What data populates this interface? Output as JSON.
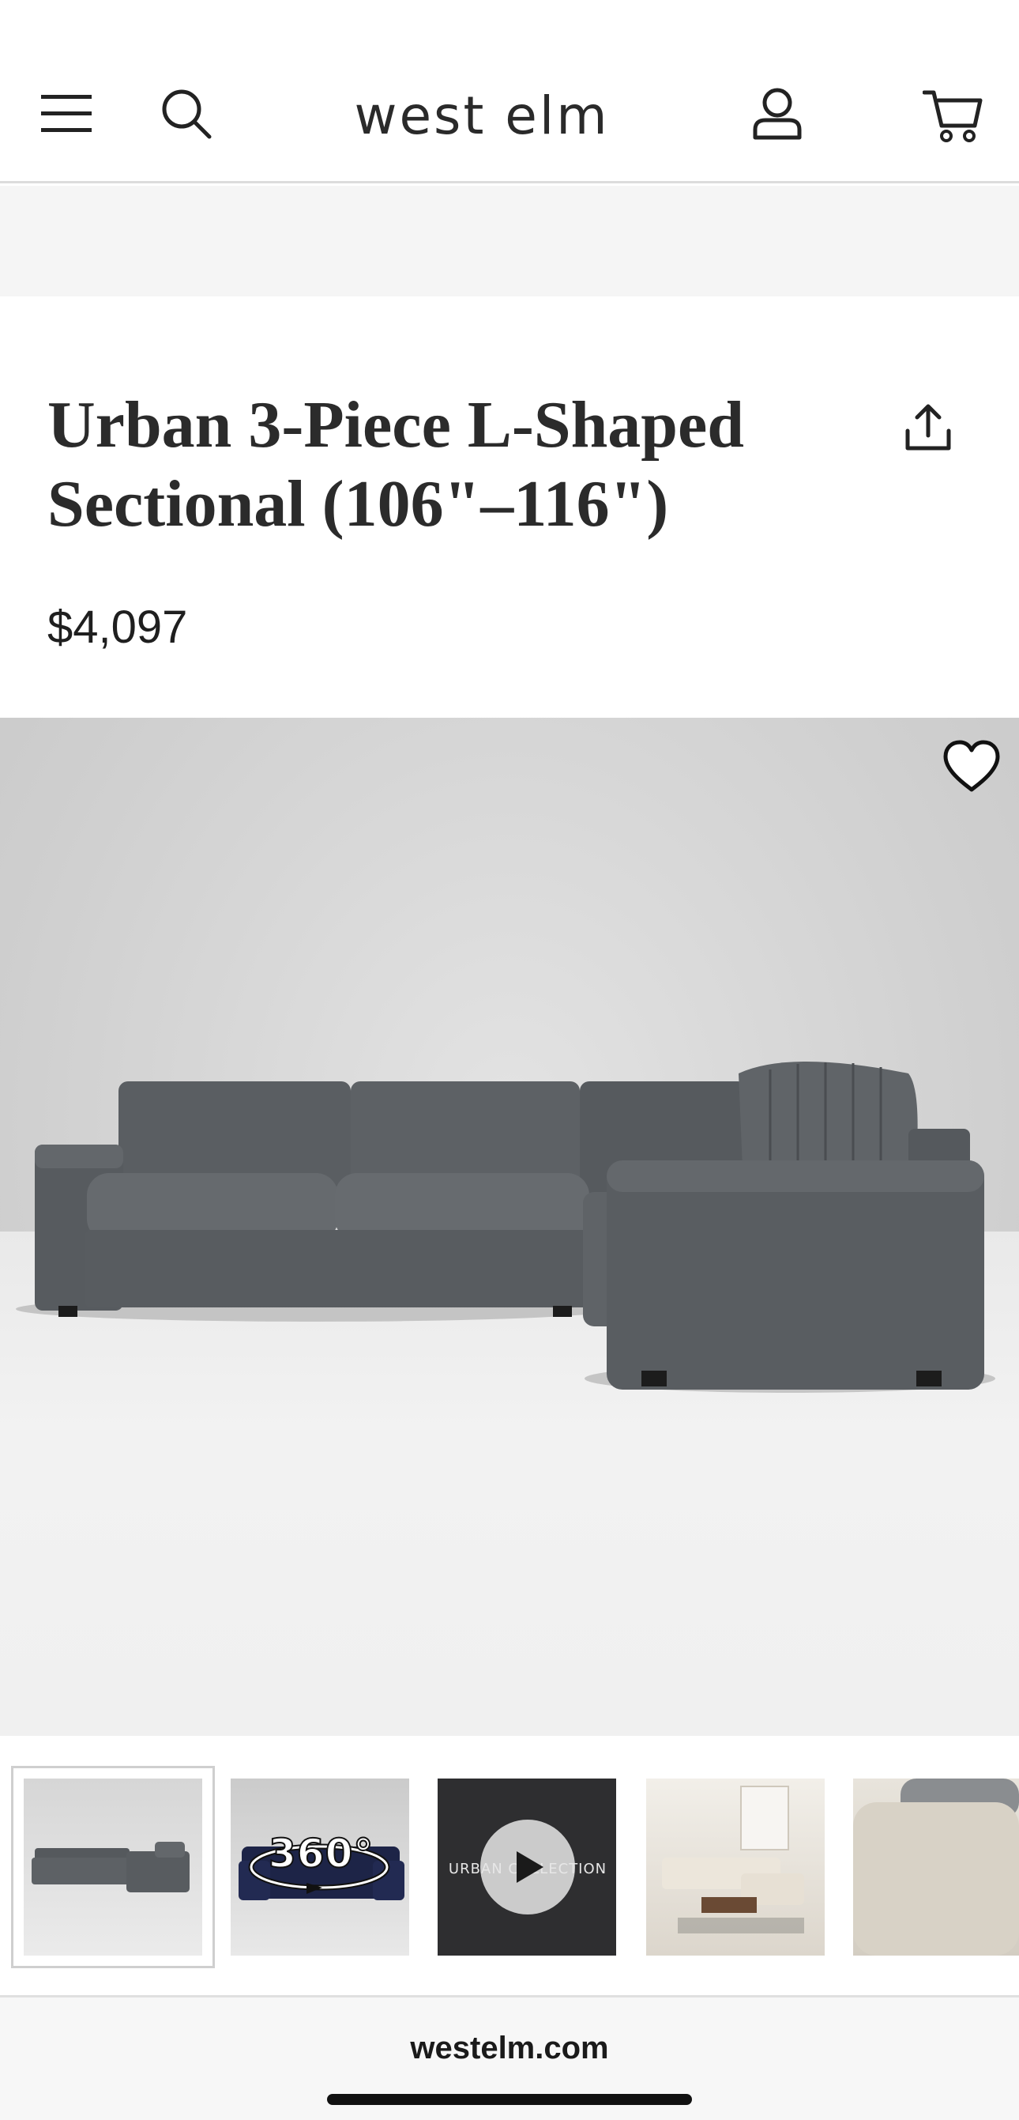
{
  "header": {
    "logo": "west elm",
    "icons": {
      "menu": "hamburger-menu-icon",
      "search": "search-icon",
      "account": "account-icon",
      "cart": "cart-icon"
    }
  },
  "product": {
    "title_line1": "Urban 3-Piece L-Shaped",
    "title_line2": "Sectional (106\"–116\")",
    "price": "$4,097",
    "share_icon": "share-icon",
    "wishlist_icon": "heart-icon",
    "sofa_color": "#5b5f63"
  },
  "thumbnails": {
    "t2_label": "360°",
    "t3_caption": "URBAN COLLECTION"
  },
  "browser": {
    "url": "westelm.com"
  }
}
